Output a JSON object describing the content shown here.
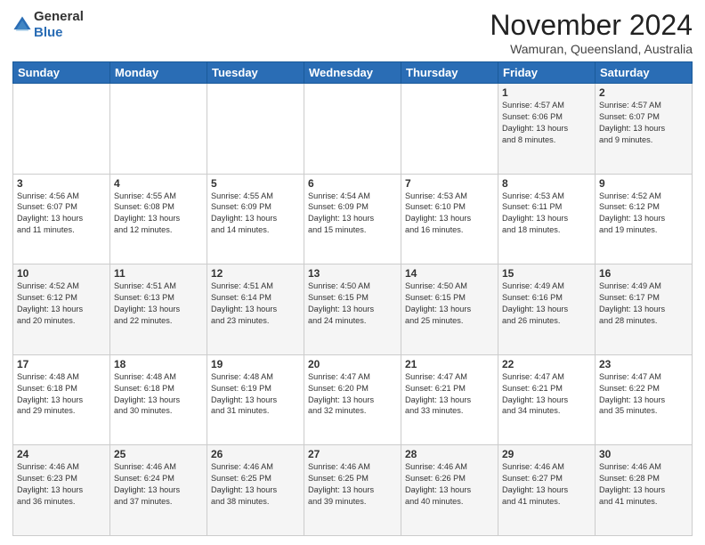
{
  "logo": {
    "line1": "General",
    "line2": "Blue"
  },
  "header": {
    "month": "November 2024",
    "location": "Wamuran, Queensland, Australia"
  },
  "weekdays": [
    "Sunday",
    "Monday",
    "Tuesday",
    "Wednesday",
    "Thursday",
    "Friday",
    "Saturday"
  ],
  "weeks": [
    [
      {
        "day": "",
        "info": ""
      },
      {
        "day": "",
        "info": ""
      },
      {
        "day": "",
        "info": ""
      },
      {
        "day": "",
        "info": ""
      },
      {
        "day": "",
        "info": ""
      },
      {
        "day": "1",
        "info": "Sunrise: 4:57 AM\nSunset: 6:06 PM\nDaylight: 13 hours\nand 8 minutes."
      },
      {
        "day": "2",
        "info": "Sunrise: 4:57 AM\nSunset: 6:07 PM\nDaylight: 13 hours\nand 9 minutes."
      }
    ],
    [
      {
        "day": "3",
        "info": "Sunrise: 4:56 AM\nSunset: 6:07 PM\nDaylight: 13 hours\nand 11 minutes."
      },
      {
        "day": "4",
        "info": "Sunrise: 4:55 AM\nSunset: 6:08 PM\nDaylight: 13 hours\nand 12 minutes."
      },
      {
        "day": "5",
        "info": "Sunrise: 4:55 AM\nSunset: 6:09 PM\nDaylight: 13 hours\nand 14 minutes."
      },
      {
        "day": "6",
        "info": "Sunrise: 4:54 AM\nSunset: 6:09 PM\nDaylight: 13 hours\nand 15 minutes."
      },
      {
        "day": "7",
        "info": "Sunrise: 4:53 AM\nSunset: 6:10 PM\nDaylight: 13 hours\nand 16 minutes."
      },
      {
        "day": "8",
        "info": "Sunrise: 4:53 AM\nSunset: 6:11 PM\nDaylight: 13 hours\nand 18 minutes."
      },
      {
        "day": "9",
        "info": "Sunrise: 4:52 AM\nSunset: 6:12 PM\nDaylight: 13 hours\nand 19 minutes."
      }
    ],
    [
      {
        "day": "10",
        "info": "Sunrise: 4:52 AM\nSunset: 6:12 PM\nDaylight: 13 hours\nand 20 minutes."
      },
      {
        "day": "11",
        "info": "Sunrise: 4:51 AM\nSunset: 6:13 PM\nDaylight: 13 hours\nand 22 minutes."
      },
      {
        "day": "12",
        "info": "Sunrise: 4:51 AM\nSunset: 6:14 PM\nDaylight: 13 hours\nand 23 minutes."
      },
      {
        "day": "13",
        "info": "Sunrise: 4:50 AM\nSunset: 6:15 PM\nDaylight: 13 hours\nand 24 minutes."
      },
      {
        "day": "14",
        "info": "Sunrise: 4:50 AM\nSunset: 6:15 PM\nDaylight: 13 hours\nand 25 minutes."
      },
      {
        "day": "15",
        "info": "Sunrise: 4:49 AM\nSunset: 6:16 PM\nDaylight: 13 hours\nand 26 minutes."
      },
      {
        "day": "16",
        "info": "Sunrise: 4:49 AM\nSunset: 6:17 PM\nDaylight: 13 hours\nand 28 minutes."
      }
    ],
    [
      {
        "day": "17",
        "info": "Sunrise: 4:48 AM\nSunset: 6:18 PM\nDaylight: 13 hours\nand 29 minutes."
      },
      {
        "day": "18",
        "info": "Sunrise: 4:48 AM\nSunset: 6:18 PM\nDaylight: 13 hours\nand 30 minutes."
      },
      {
        "day": "19",
        "info": "Sunrise: 4:48 AM\nSunset: 6:19 PM\nDaylight: 13 hours\nand 31 minutes."
      },
      {
        "day": "20",
        "info": "Sunrise: 4:47 AM\nSunset: 6:20 PM\nDaylight: 13 hours\nand 32 minutes."
      },
      {
        "day": "21",
        "info": "Sunrise: 4:47 AM\nSunset: 6:21 PM\nDaylight: 13 hours\nand 33 minutes."
      },
      {
        "day": "22",
        "info": "Sunrise: 4:47 AM\nSunset: 6:21 PM\nDaylight: 13 hours\nand 34 minutes."
      },
      {
        "day": "23",
        "info": "Sunrise: 4:47 AM\nSunset: 6:22 PM\nDaylight: 13 hours\nand 35 minutes."
      }
    ],
    [
      {
        "day": "24",
        "info": "Sunrise: 4:46 AM\nSunset: 6:23 PM\nDaylight: 13 hours\nand 36 minutes."
      },
      {
        "day": "25",
        "info": "Sunrise: 4:46 AM\nSunset: 6:24 PM\nDaylight: 13 hours\nand 37 minutes."
      },
      {
        "day": "26",
        "info": "Sunrise: 4:46 AM\nSunset: 6:25 PM\nDaylight: 13 hours\nand 38 minutes."
      },
      {
        "day": "27",
        "info": "Sunrise: 4:46 AM\nSunset: 6:25 PM\nDaylight: 13 hours\nand 39 minutes."
      },
      {
        "day": "28",
        "info": "Sunrise: 4:46 AM\nSunset: 6:26 PM\nDaylight: 13 hours\nand 40 minutes."
      },
      {
        "day": "29",
        "info": "Sunrise: 4:46 AM\nSunset: 6:27 PM\nDaylight: 13 hours\nand 41 minutes."
      },
      {
        "day": "30",
        "info": "Sunrise: 4:46 AM\nSunset: 6:28 PM\nDaylight: 13 hours\nand 41 minutes."
      }
    ]
  ]
}
